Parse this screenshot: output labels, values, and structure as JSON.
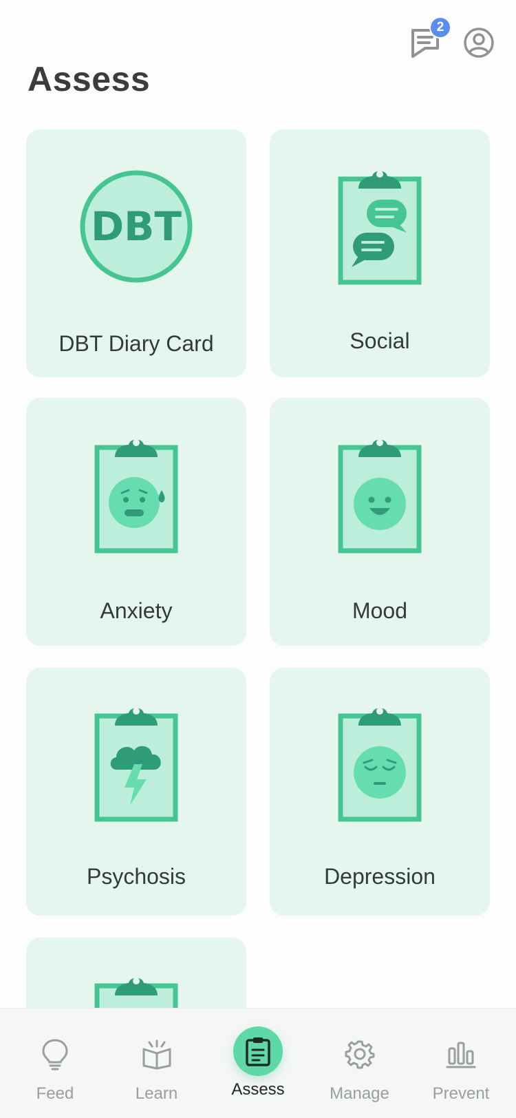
{
  "header": {
    "title": "Assess",
    "messages_badge": "2",
    "icons": [
      "chat-icon",
      "profile-icon"
    ]
  },
  "cards": [
    {
      "label": "DBT Diary Card",
      "icon": "dbt-badge-icon",
      "icon_text": "DBT"
    },
    {
      "label": "Social",
      "icon": "clipboard-chat-icon"
    },
    {
      "label": "Anxiety",
      "icon": "clipboard-anxious-face-icon"
    },
    {
      "label": "Mood",
      "icon": "clipboard-smile-face-icon"
    },
    {
      "label": "Psychosis",
      "icon": "clipboard-storm-icon"
    },
    {
      "label": "Depression",
      "icon": "clipboard-sad-face-icon"
    }
  ],
  "nav": {
    "items": [
      {
        "label": "Feed",
        "icon": "lightbulb-icon"
      },
      {
        "label": "Learn",
        "icon": "open-book-icon"
      },
      {
        "label": "Assess",
        "icon": "clipboard-icon",
        "active": true
      },
      {
        "label": "Manage",
        "icon": "gear-icon"
      },
      {
        "label": "Prevent",
        "icon": "bar-chart-icon"
      }
    ]
  },
  "colors": {
    "card_bg": "#e5f6ef",
    "green_dark": "#2f9b78",
    "green_mid": "#45c593",
    "green_light": "#bdeedb",
    "green_face": "#66ddb0",
    "badge_blue": "#5b8def",
    "nav_active": "#5fd8a8"
  }
}
